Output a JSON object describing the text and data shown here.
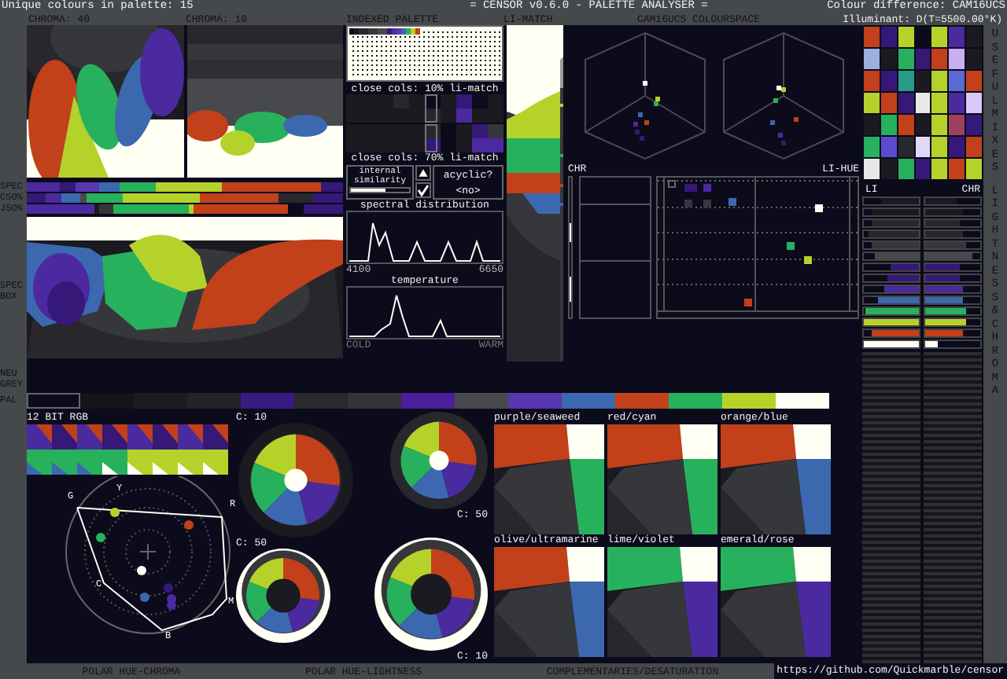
{
  "header": {
    "palette_count": "Unique colours in palette: 15",
    "title": "= CENSOR v0.6.0 - PALETTE ANALYSER =",
    "colour_difference": "Colour difference: CAM16UCS",
    "illuminant": "Illuminant: D(T=5500.00°K)"
  },
  "chroma_panels": [
    {
      "label": "CHROMA: 40"
    },
    {
      "label": "CHROMA: 10"
    }
  ],
  "bar_rows": [
    {
      "label": "SPEC"
    },
    {
      "label": "CSO%"
    },
    {
      "label": "JSO%"
    }
  ],
  "spec_box": {
    "label_lines": [
      "SPEC",
      "BOX"
    ]
  },
  "neutral_grey": {
    "label_lines": [
      "NEU",
      "GREY"
    ]
  },
  "palette_strip": {
    "label": "PAL"
  },
  "indexed_palette": {
    "title": "INDEXED PALETTE"
  },
  "close_cols": [
    {
      "title": "close cols: 10% li-match"
    },
    {
      "title": "close cols: 70% li-match"
    }
  ],
  "internal_similarity": {
    "label": "internal similarity",
    "level": 0.6
  },
  "acyclic": {
    "label": "acyclic?",
    "value": "<no>",
    "checked": true
  },
  "spectral": {
    "title": "spectral distribution",
    "min": "4100",
    "max": "6650"
  },
  "temperature": {
    "title": "temperature",
    "min": "COLD",
    "max": "WARM"
  },
  "li_match": {
    "title": "LI-MATCH"
  },
  "colourspace": {
    "title": "CAM16UCS COLOURSPACE",
    "left_label": "CHR",
    "right_label": "LI-HUE"
  },
  "useful_mixes": {
    "title": "USEFUL MIXES"
  },
  "lightness_chroma": {
    "title": "LIGHTNESS & CHROMA",
    "left": "LI",
    "right": "CHR"
  },
  "rgb12": {
    "title": "12 BIT RGB"
  },
  "polar_hue_chroma": {
    "title": "POLAR HUE-CHROMA",
    "markers": [
      "G",
      "Y",
      "R",
      "C",
      "M",
      "B"
    ]
  },
  "polar_hue_lightness": {
    "title": "POLAR HUE-LIGHTNESS",
    "labels": [
      "C: 10",
      "C: 50",
      "C: 50",
      "C: 10"
    ]
  },
  "complementaries": {
    "title": "COMPLEMENTARIES/DESATURATION",
    "pairs": [
      {
        "label": "purple/seaweed"
      },
      {
        "label": "red/cyan"
      },
      {
        "label": "orange/blue"
      },
      {
        "label": "olive/ultramarine"
      },
      {
        "label": "lime/violet"
      },
      {
        "label": "emerald/rose"
      }
    ]
  },
  "footer": {
    "url": "https://github.com/Quickmarble/censor"
  }
}
